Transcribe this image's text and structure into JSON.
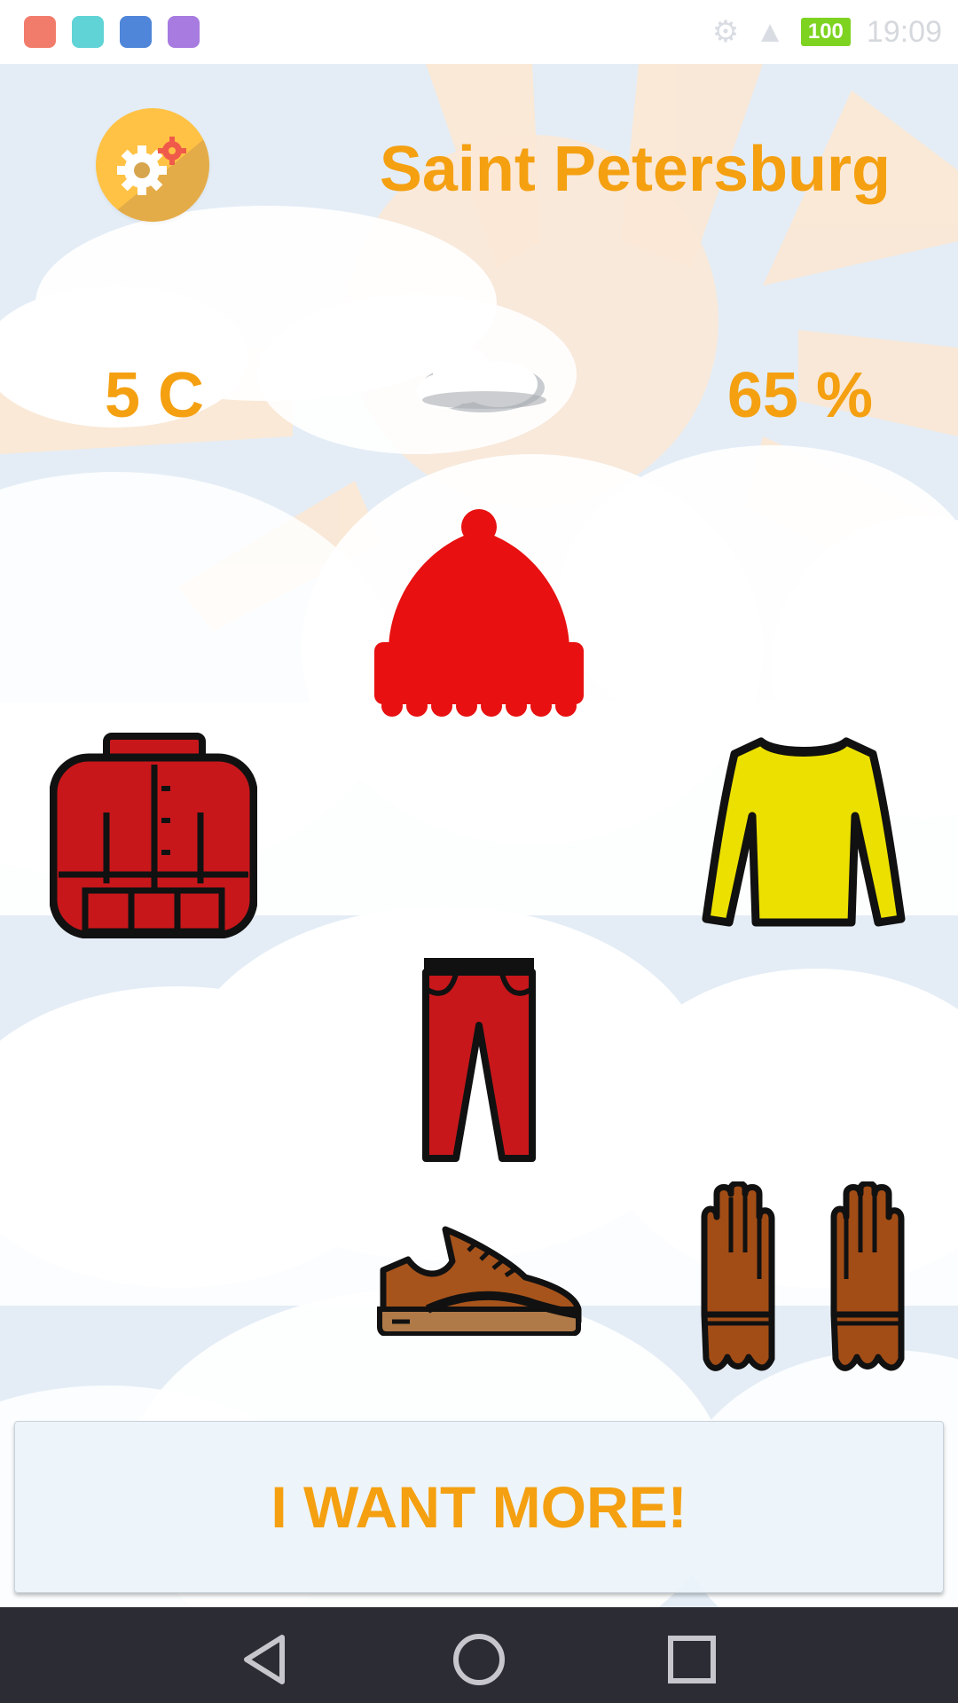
{
  "status_bar": {
    "app_icons": [
      "email-app-icon",
      "android-app-icon",
      "vk-app-icon",
      "gallery-app-icon"
    ],
    "app_icon_colors": [
      "#f27c6c",
      "#5fd3d6",
      "#4f86d9",
      "#a77be0"
    ],
    "battery": "100",
    "time": "19:09"
  },
  "header": {
    "settings_icon": "gear-icon",
    "city": "Saint Petersburg"
  },
  "weather": {
    "temperature": "5 C",
    "condition_icon": "cloud-icon",
    "humidity": "65 %"
  },
  "clothing": [
    "hat-icon",
    "jacket-icon",
    "sweater-icon",
    "pants-icon",
    "sneaker-icon",
    "gloves-icon"
  ],
  "action": {
    "label": "I WANT MORE!"
  },
  "nav": [
    "back-icon",
    "home-icon",
    "recents-icon"
  ],
  "colors": {
    "accent": "#f4a011",
    "nav_bg": "#2c2c34"
  }
}
